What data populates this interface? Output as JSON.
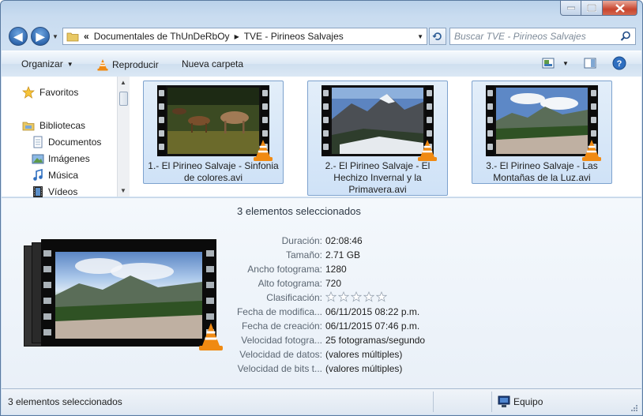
{
  "window": {
    "caption_buttons": [
      "minimize",
      "maximize",
      "close"
    ]
  },
  "address_bar": {
    "chevron": "«",
    "crumbs": [
      "Documentales de ThUnDeRbOy",
      "TVE - Pirineos Salvajes"
    ],
    "separator": "▶"
  },
  "search": {
    "placeholder": "Buscar TVE - Pirineos Salvajes"
  },
  "toolbar": {
    "organize": "Organizar",
    "play": "Reproducir",
    "new_folder": "Nueva carpeta"
  },
  "nav_pane": {
    "favorites": "Favoritos",
    "libraries": "Bibliotecas",
    "items": [
      "Documentos",
      "Imágenes",
      "Música",
      "Vídeos"
    ]
  },
  "files": [
    {
      "label": "1.- El Pirineo Salvaje - Sinfonia de colores.avi",
      "scene": "horses"
    },
    {
      "label": "2.- El Pirineo Salvaje - El Hechizo Invernal y la Primavera.avi",
      "scene": "snow"
    },
    {
      "label": "3.- El Pirineo Salvaje - Las Montañas de la Luz.avi",
      "scene": "valley"
    }
  ],
  "details": {
    "header": "3 elementos seleccionados",
    "properties": [
      {
        "label": "Duración:",
        "value": "02:08:46"
      },
      {
        "label": "Tamaño:",
        "value": "2.71 GB"
      },
      {
        "label": "Ancho fotograma:",
        "value": "1280"
      },
      {
        "label": "Alto fotograma:",
        "value": "720"
      },
      {
        "label": "Clasificación:",
        "value": ""
      },
      {
        "label": "Fecha de modifica...",
        "value": "06/11/2015 08:22 p.m."
      },
      {
        "label": "Fecha de creación:",
        "value": "06/11/2015 07:46 p.m."
      },
      {
        "label": "Velocidad fotogra...",
        "value": "25 fotogramas/segundo"
      },
      {
        "label": "Velocidad de datos:",
        "value": "(valores múltiples)"
      },
      {
        "label": "Velocidad de bits t...",
        "value": "(valores múltiples)"
      }
    ],
    "rating_stars": 0,
    "rating_max": 5
  },
  "status": {
    "left": "3 elementos seleccionados",
    "right": "Equipo"
  }
}
